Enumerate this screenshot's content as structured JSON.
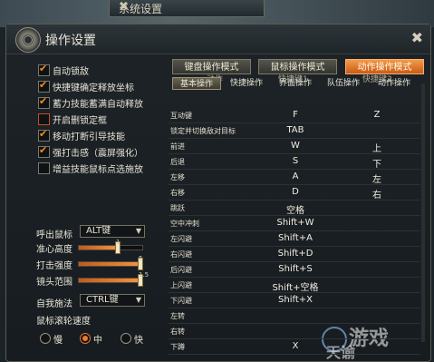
{
  "bg_window": {
    "title": "系统设置"
  },
  "dialog": {
    "title": "操作设置"
  },
  "options": [
    {
      "label": "自动锁敌",
      "checked": true
    },
    {
      "label": "快捷键确定释放坐标",
      "checked": true
    },
    {
      "label": "蓄力技能蓄满自动释放",
      "checked": true
    },
    {
      "label": "开启删锁定框",
      "checked": false
    },
    {
      "label": "移动打断引导技能",
      "checked": true
    },
    {
      "label": "强打击感（震屏强化）",
      "checked": true
    },
    {
      "label": "增益技能鼠标点选施放",
      "checked": false
    }
  ],
  "controls": {
    "mouse_call_label": "呼出鼠标",
    "mouse_call_value": "ALT键",
    "aim_height_label": "准心高度",
    "aim_height_value": "1",
    "aim_height_fraction": 0.6,
    "hit_strength_label": "打击强度",
    "hit_strength_value": "5",
    "hit_strength_fraction": 0.95,
    "lens_range_label": "镜头范围",
    "lens_range_value": "1.5",
    "lens_range_fraction": 0.95,
    "self_cast_label": "自我施法",
    "self_cast_value": "CTRL键",
    "wheel_speed_label": "鼠标滚轮速度",
    "speed_options": [
      "慢",
      "中",
      "快"
    ],
    "speed_selected": "中"
  },
  "tabs": [
    "键盘操作模式",
    "鼠标操作模式",
    "动作操作模式"
  ],
  "active_tab": "动作操作模式",
  "subtabs": [
    "基本操作",
    "快捷操作",
    "界面操作",
    "队伍操作",
    "动作操作"
  ],
  "active_subtab": "基本操作",
  "table_headers": [
    "动作",
    "快捷键1",
    "快捷键2"
  ],
  "rows": [
    {
      "action": "互动键",
      "key1": "F",
      "key2": "Z"
    },
    {
      "action": "锁定并切换敌对目标",
      "key1": "TAB",
      "key2": ""
    },
    {
      "action": "前进",
      "key1": "W",
      "key2": "上"
    },
    {
      "action": "后退",
      "key1": "S",
      "key2": "下"
    },
    {
      "action": "左移",
      "key1": "A",
      "key2": "左"
    },
    {
      "action": "右移",
      "key1": "D",
      "key2": "右"
    },
    {
      "action": "跳跃",
      "key1": "空格",
      "key2": ""
    },
    {
      "action": "空中冲刺",
      "key1": "Shift+W",
      "key2": ""
    },
    {
      "action": "左闪避",
      "key1": "Shift+A",
      "key2": ""
    },
    {
      "action": "右闪避",
      "key1": "Shift+D",
      "key2": ""
    },
    {
      "action": "后闪避",
      "key1": "Shift+S",
      "key2": ""
    },
    {
      "action": "上闪避",
      "key1": "Shift+空格",
      "key2": ""
    },
    {
      "action": "下闪避",
      "key1": "Shift+X",
      "key2": ""
    },
    {
      "action": "左转",
      "key1": "",
      "key2": ""
    },
    {
      "action": "右转",
      "key1": "",
      "key2": ""
    },
    {
      "action": "下蹲",
      "key1": "X",
      "key2": ""
    }
  ],
  "colors": {
    "accent": "#f07a26",
    "panel_bg": "#1b2227",
    "border": "#5c5a50"
  },
  "icons": {
    "dialog": "gear-icon",
    "close": "close-icon",
    "bg_close": "close-icon"
  },
  "watermark": {
    "text": "游戏",
    "text2": "天谕"
  }
}
